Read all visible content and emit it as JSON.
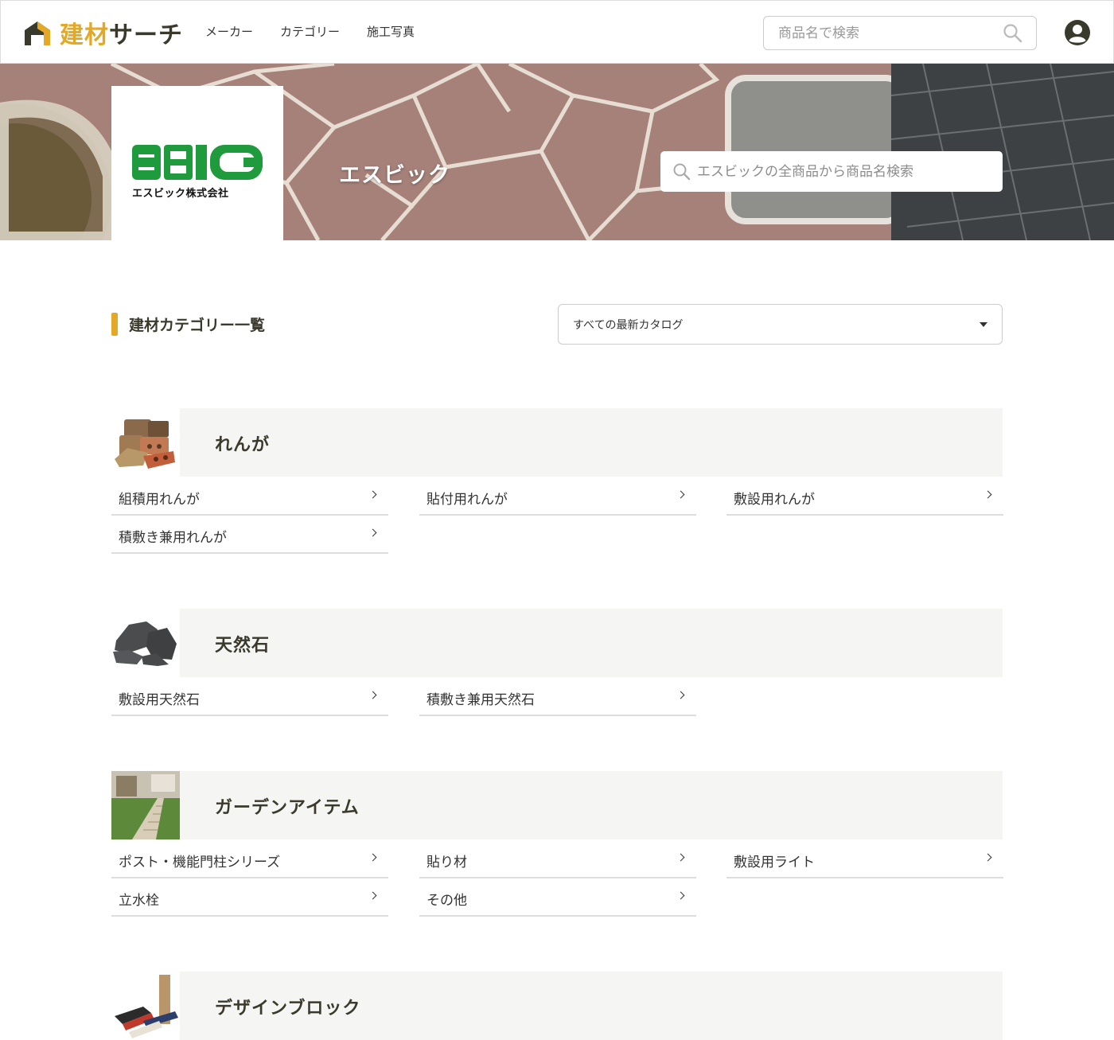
{
  "header": {
    "logo_part1": "建材",
    "logo_part2": "サーチ",
    "nav": [
      "メーカー",
      "カテゴリー",
      "施工写真"
    ],
    "search_placeholder": "商品名で検索",
    "search_icon": "search-icon",
    "account_icon": "user-circle-icon"
  },
  "hero": {
    "brand_logo_text": "SBIC",
    "brand_logo_subtext": "エスビック株式会社",
    "brand_name": "エスビック",
    "search_placeholder": "エスビックの全商品から商品名検索"
  },
  "section": {
    "title": "建材カテゴリー一覧",
    "catalog_select": "すべての最新カタログ"
  },
  "categories": [
    {
      "title": "れんが",
      "items": [
        "組積用れんが",
        "貼付用れんが",
        "敷設用れんが",
        "積敷き兼用れんが"
      ]
    },
    {
      "title": "天然石",
      "items": [
        "敷設用天然石",
        "積敷き兼用天然石"
      ]
    },
    {
      "title": "ガーデンアイテム",
      "items": [
        "ポスト・機能門柱シリーズ",
        "貼り材",
        "敷設用ライト",
        "立水栓",
        "その他"
      ]
    },
    {
      "title": "デザインブロック",
      "items": []
    }
  ],
  "colors": {
    "accent": "#e3a825",
    "dark": "#3a3a2c",
    "band": "#f5f5f3",
    "brand_green": "#1f9a3c"
  }
}
